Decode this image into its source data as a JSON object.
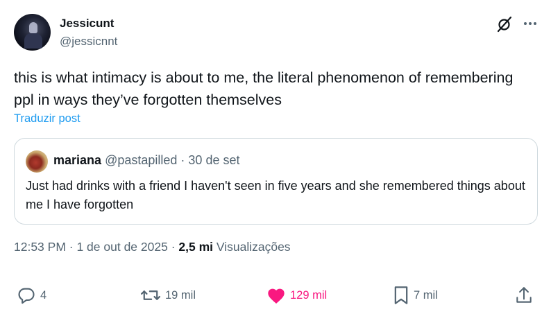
{
  "author": {
    "display_name": "Jessicunt",
    "handle": "@jessicnnt"
  },
  "post": {
    "text": "this is what intimacy is about to me, the literal phenomenon of remembering ppl in ways they’ve forgotten themselves",
    "translate_label": "Traduzir post"
  },
  "quote": {
    "display_name": "mariana",
    "handle": "@pastapilled",
    "date": "· 30 de set",
    "text": "Just had drinks with a friend I haven't seen in five years and she remembered things about me I have forgotten"
  },
  "meta": {
    "time_date": "12:53 PM · 1 de out de 2025 · ",
    "views_count": "2,5 mi",
    "views_label": " Visualizações"
  },
  "actions": {
    "replies": "4",
    "reposts": "19 mil",
    "likes": "129 mil",
    "bookmarks": "7 mil"
  },
  "colors": {
    "accent": "#1d9bf0",
    "like": "#f91880",
    "secondary_text": "#536471",
    "border": "#cfd9de"
  },
  "icons": [
    "grok-icon",
    "more-icon",
    "reply-icon",
    "repost-icon",
    "heart-icon",
    "bookmark-icon",
    "share-icon"
  ]
}
